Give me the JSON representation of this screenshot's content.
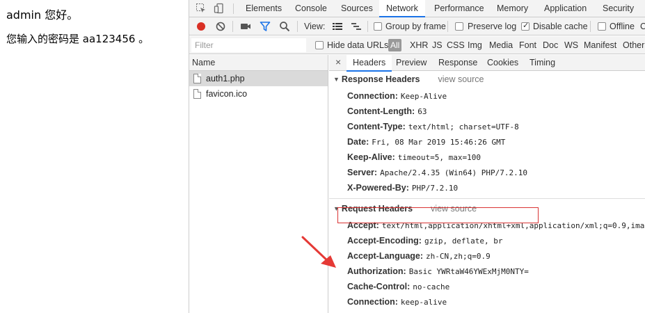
{
  "page": {
    "line1": "admin 您好。",
    "line2": "您输入的密码是 aa123456 。"
  },
  "devtools": {
    "tabs": [
      "Elements",
      "Console",
      "Sources",
      "Network",
      "Performance",
      "Memory",
      "Application",
      "Security"
    ],
    "active_tab": "Network",
    "toolbar": {
      "view_label": "View:",
      "group_by_frame": "Group by frame",
      "preserve_log": "Preserve log",
      "disable_cache": "Disable cache",
      "disable_cache_checked": true,
      "offline": "Offline",
      "offline_trail": "C"
    },
    "filter": {
      "placeholder": "Filter",
      "hide_data_urls": "Hide data URLs",
      "all": "All",
      "types": [
        "XHR",
        "JS",
        "CSS",
        "Img",
        "Media",
        "Font",
        "Doc",
        "WS",
        "Manifest",
        "Other"
      ]
    },
    "request_list": {
      "header": "Name",
      "items": [
        "auth1.php",
        "favicon.ico"
      ]
    },
    "details": {
      "close": "×",
      "tabs": [
        "Headers",
        "Preview",
        "Response",
        "Cookies",
        "Timing"
      ],
      "active_tab": "Headers",
      "response_headers": {
        "title": "Response Headers",
        "view_source": "view source",
        "rows": [
          {
            "k": "Connection:",
            "v": "Keep-Alive"
          },
          {
            "k": "Content-Length:",
            "v": "63"
          },
          {
            "k": "Content-Type:",
            "v": "text/html; charset=UTF-8"
          },
          {
            "k": "Date:",
            "v": "Fri, 08 Mar 2019 15:46:26 GMT"
          },
          {
            "k": "Keep-Alive:",
            "v": "timeout=5, max=100"
          },
          {
            "k": "Server:",
            "v": "Apache/2.4.35 (Win64) PHP/7.2.10"
          },
          {
            "k": "X-Powered-By:",
            "v": "PHP/7.2.10"
          }
        ]
      },
      "request_headers": {
        "title": "Request Headers",
        "view_source": "view source",
        "rows": [
          {
            "k": "Accept:",
            "v": "text/html,application/xhtml+xml,application/xml;q=0.9,imag"
          },
          {
            "k": "Accept-Encoding:",
            "v": "gzip, deflate, br"
          },
          {
            "k": "Accept-Language:",
            "v": "zh-CN,zh;q=0.9"
          },
          {
            "k": "Authorization:",
            "v": "Basic YWRtaW46YWExMjM0NTY="
          },
          {
            "k": "Cache-Control:",
            "v": "no-cache"
          },
          {
            "k": "Connection:",
            "v": "keep-alive"
          }
        ]
      }
    },
    "colors": {
      "accent": "#1a73e8",
      "record": "#d93025",
      "annotation": "#e53935"
    }
  }
}
